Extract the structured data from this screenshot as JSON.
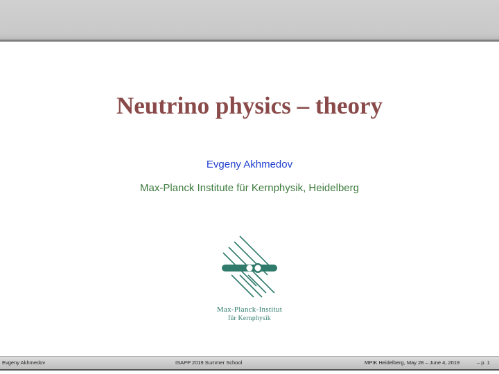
{
  "slide": {
    "title": "Neutrino physics – theory",
    "author": "Evgeny Akhmedov",
    "affiliation": "Max-Planck Institute für Kernphysik, Heidelberg"
  },
  "logo": {
    "line1": "Max-Planck-Institut",
    "line2": "für Kernphysik",
    "color": "#2f7a6b"
  },
  "footer": {
    "left": "Evgeny Akhmedov",
    "center": "ISAPP 2019 Summer School",
    "right": "MPIK Heidelberg, May 28 – June 4, 2019",
    "page": "– p. 1"
  },
  "colors": {
    "title": "#8a4a4a",
    "author": "#1f3fcf",
    "affiliation": "#3c7a3c"
  }
}
